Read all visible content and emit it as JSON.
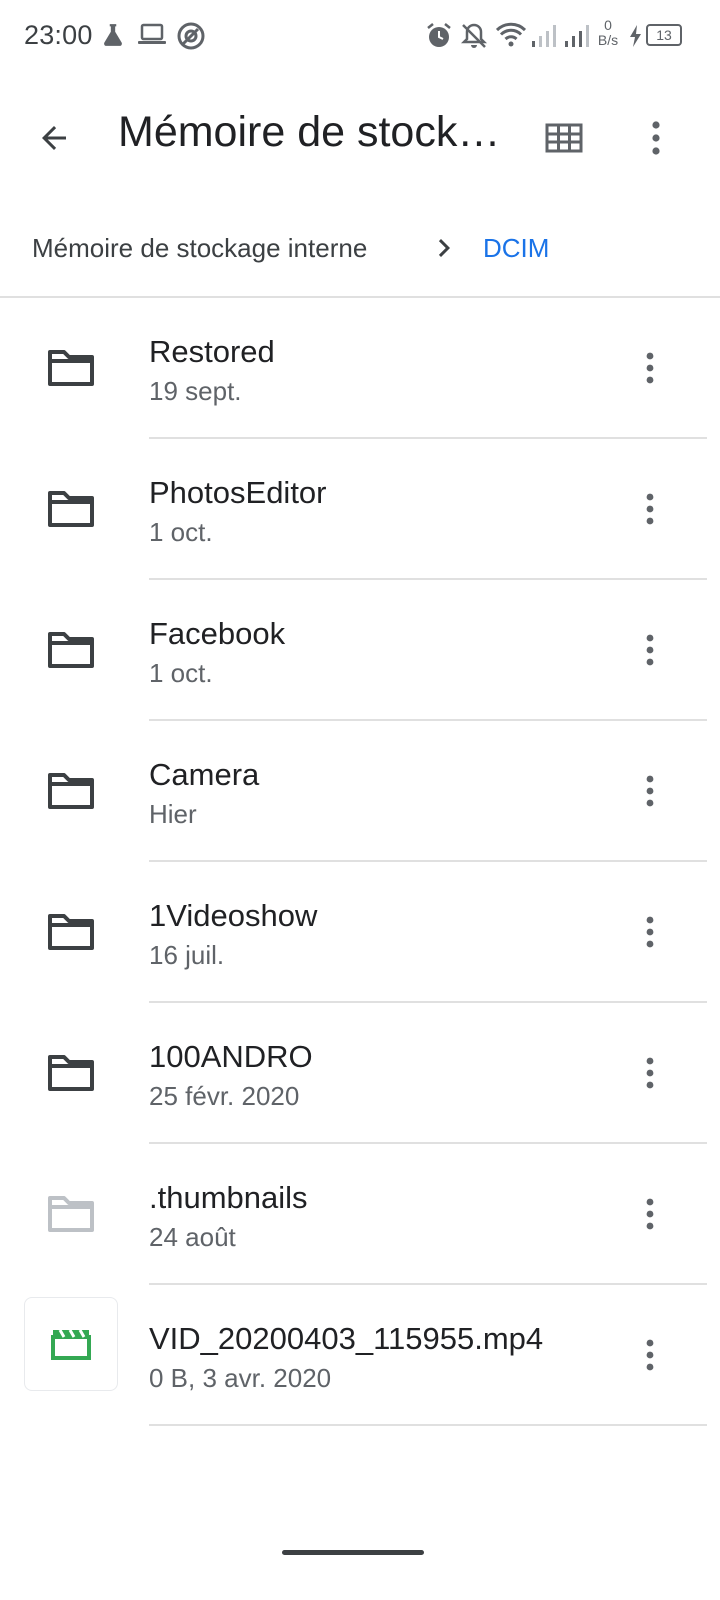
{
  "status_bar": {
    "time": "23:00",
    "net_speed_value": "0",
    "net_speed_unit": "B/s",
    "battery": "13",
    "icons": [
      "flask-icon",
      "laptop-icon",
      "app-circle-icon",
      "alarm-icon",
      "bell-off-icon",
      "wifi-icon",
      "signal-icon",
      "signal-icon",
      "charging-icon",
      "battery-icon"
    ]
  },
  "app_bar": {
    "title": "Mémoire de stock…",
    "back_icon": "arrow-back-icon",
    "view_icon": "grid-view-icon",
    "menu_icon": "more-vert-icon"
  },
  "breadcrumb": {
    "root": "Mémoire de stockage interne",
    "current": "DCIM"
  },
  "files": [
    {
      "name": "Restored",
      "meta": "19 sept.",
      "type": "folder"
    },
    {
      "name": "PhotosEditor",
      "meta": "1 oct.",
      "type": "folder"
    },
    {
      "name": "Facebook",
      "meta": "1 oct.",
      "type": "folder"
    },
    {
      "name": "Camera",
      "meta": "Hier",
      "type": "folder"
    },
    {
      "name": "1Videoshow",
      "meta": "16 juil.",
      "type": "folder"
    },
    {
      "name": "100ANDRO",
      "meta": "25 févr. 2020",
      "type": "folder"
    },
    {
      "name": ".thumbnails",
      "meta": "24 août",
      "type": "folder-hidden"
    },
    {
      "name": "VID_20200403_115955.mp4",
      "meta": "0 B, 3 avr. 2020",
      "type": "video"
    }
  ],
  "colors": {
    "accent": "#1a73e8",
    "text_primary": "#202124",
    "text_secondary": "#5f6368",
    "icon": "#3c4043",
    "hidden_folder": "#bdc1c6",
    "video_icon": "#34a853",
    "divider": "#e0e0e0"
  }
}
